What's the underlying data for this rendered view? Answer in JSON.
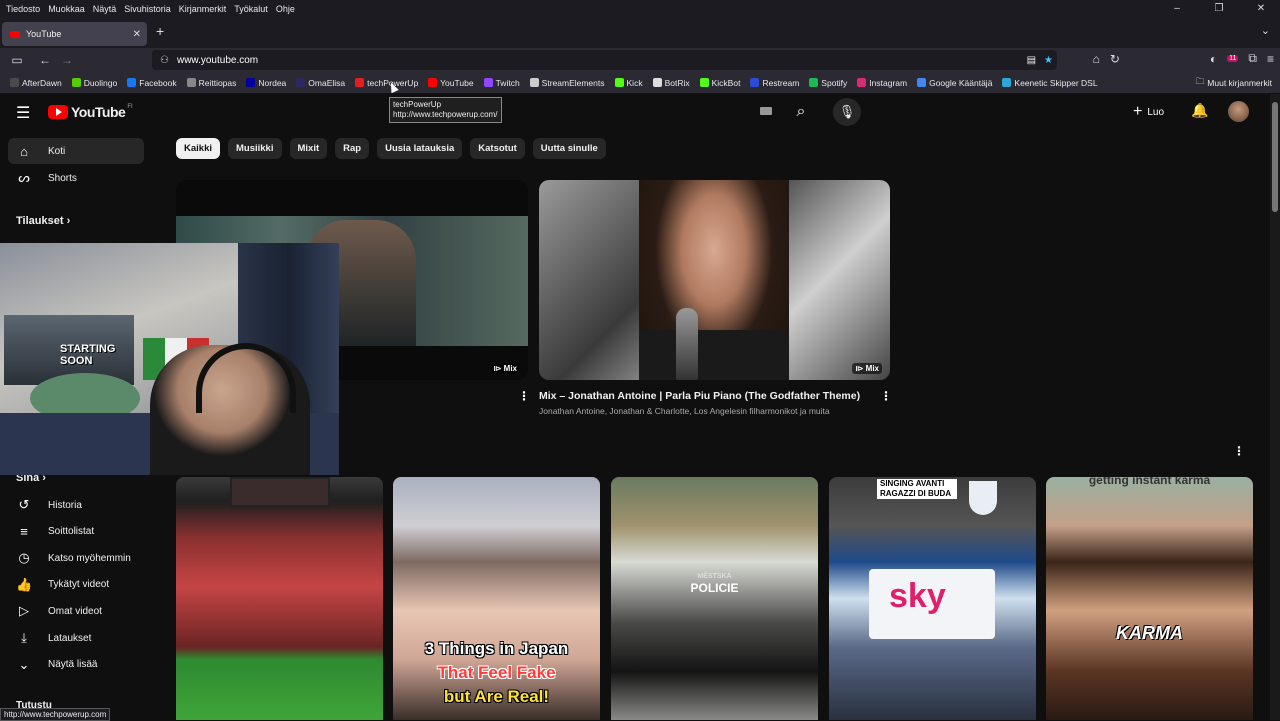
{
  "menubar": {
    "items": [
      "Tiedosto",
      "Muokkaa",
      "Näytä",
      "Sivuhistoria",
      "Kirjanmerkit",
      "Työkalut",
      "Ohje"
    ]
  },
  "tab": {
    "title": "YouTube"
  },
  "address": {
    "host": "www.youtube.com"
  },
  "bookmarks": {
    "items": [
      {
        "label": "AfterDawn",
        "color": "#4a4a4a"
      },
      {
        "label": "Duolingo",
        "color": "#58cc02"
      },
      {
        "label": "Facebook",
        "color": "#1877f2"
      },
      {
        "label": "Reittiopas",
        "color": "#888888"
      },
      {
        "label": "Nordea",
        "color": "#0000a0"
      },
      {
        "label": "OmaElisa",
        "color": "#2a2a60"
      },
      {
        "label": "techPowerUp",
        "color": "#e02020"
      },
      {
        "label": "YouTube",
        "color": "#ff0000"
      },
      {
        "label": "Twitch",
        "color": "#9146ff"
      },
      {
        "label": "StreamElements",
        "color": "#cccccc"
      },
      {
        "label": "Kick",
        "color": "#53fc18"
      },
      {
        "label": "BotRix",
        "color": "#dddddd"
      },
      {
        "label": "KickBot",
        "color": "#53fc18"
      },
      {
        "label": "Restream",
        "color": "#2a4ad8"
      },
      {
        "label": "Spotify",
        "color": "#1db954"
      },
      {
        "label": "Instagram",
        "color": "#d62976"
      },
      {
        "label": "Google Kääntäjä",
        "color": "#4285f4"
      },
      {
        "label": "Keenetic Skipper DSL",
        "color": "#2aa8d8"
      }
    ],
    "other": "Muut kirjanmerkit"
  },
  "tooltip": {
    "title": "techPowerUp",
    "url": "http://www.techpowerup.com/"
  },
  "extension_badge": "11",
  "youtube": {
    "logo_text": "YouTube",
    "region": "FI",
    "create_label": "Luo"
  },
  "sidebar": {
    "items": [
      {
        "label": "Koti",
        "icon": "home-icon"
      },
      {
        "label": "Shorts",
        "icon": "shorts-icon"
      }
    ],
    "subscriptions": "Tilaukset",
    "you": "Sinä",
    "you_items": [
      {
        "label": "Historia",
        "icon": "history-icon"
      },
      {
        "label": "Soittolistat",
        "icon": "playlists-icon"
      },
      {
        "label": "Katso myöhemmin",
        "icon": "watch-later-icon"
      },
      {
        "label": "Tykätyt videot",
        "icon": "liked-icon"
      },
      {
        "label": "Omat videot",
        "icon": "your-videos-icon"
      },
      {
        "label": "Lataukset",
        "icon": "downloads-icon"
      },
      {
        "label": "Näytä lisää",
        "icon": "chevron-down-icon"
      }
    ],
    "explore": "Tutustu"
  },
  "chips": [
    "Kaikki",
    "Musiikki",
    "Mixit",
    "Rap",
    "Uusia latauksia",
    "Katsotut",
    "Uutta sinulle"
  ],
  "videos": [
    {
      "badge": "Mix"
    },
    {
      "badge": "Mix",
      "title": "Mix – Jonathan Antoine | Parla Piu Piano (The Godfather Theme)",
      "channel": "Jonathan Antoine, Jonathan & Charlotte, Los Angelesin filharmonikot ja muita"
    }
  ],
  "webcam": {
    "poster_text": "STARTING SOON"
  },
  "shorts": [
    {
      "lines": []
    },
    {
      "lines": [
        "3 Things in Japan",
        "That Feel Fake",
        "but Are Real!"
      ]
    },
    {
      "top": "MĚSTSKÁ",
      "label": "POLICIE"
    },
    {
      "caption": "SINGING AVANTI RAGAZZI DI BUDA",
      "brand": "sky"
    },
    {
      "top": "getting instant karma",
      "label": "KARMA"
    }
  ],
  "statusbar": "http://www.techpowerup.com"
}
